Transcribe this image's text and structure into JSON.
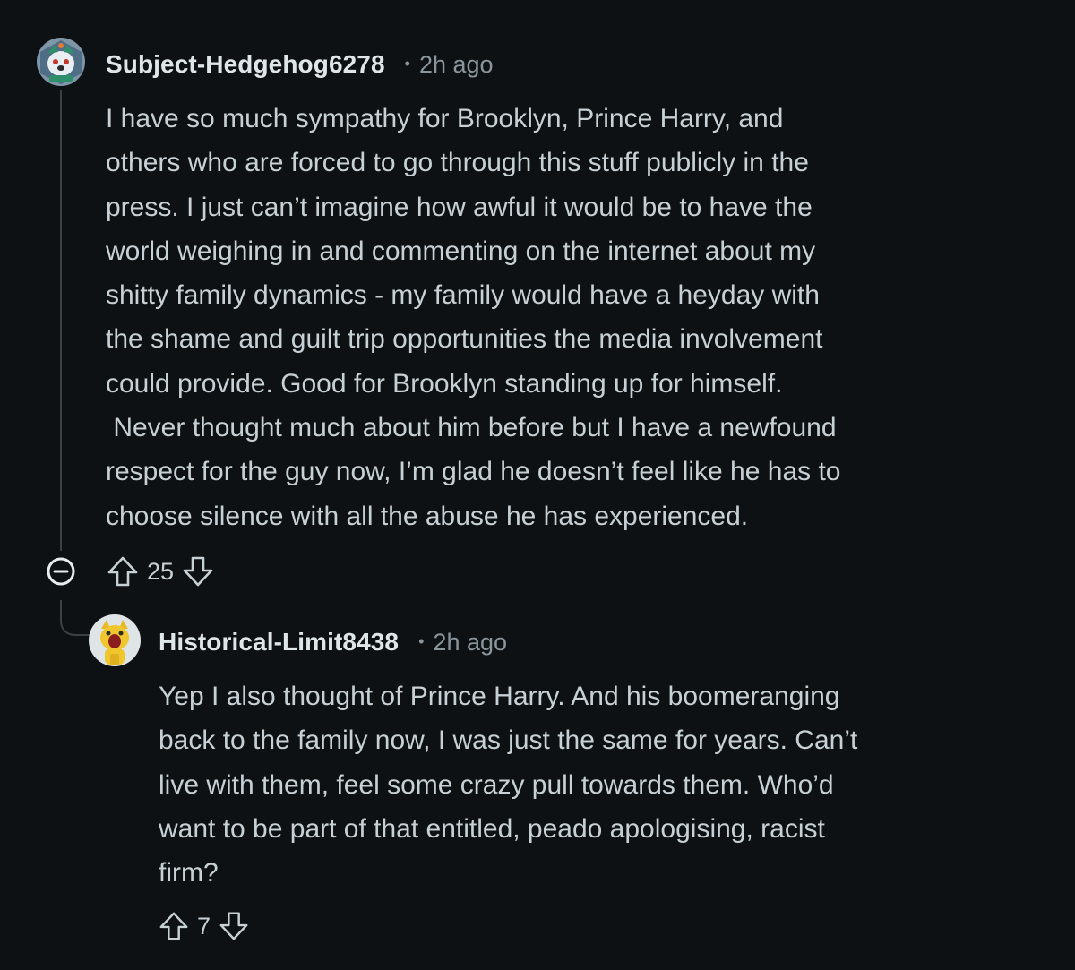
{
  "comments": [
    {
      "username": "Subject-Hedgehog6278",
      "separator": "•",
      "time": "2h ago",
      "avatar_icon": "hedgehog-avatar-icon",
      "body_lines": [
        "I have so much sympathy for Brooklyn, Prince Harry, and",
        "others who are forced to go through this stuff publicly in the",
        "press.  I just can’t imagine how awful it would be to have the",
        "world weighing in and commenting on the internet about my",
        "shitty family dynamics - my family would have a heyday with",
        "the shame and guilt trip opportunities the media involvement",
        "could provide.  Good for Brooklyn standing up for himself.",
        " Never thought much about him before but I have a newfound",
        "respect for the guy now, I’m glad he doesn’t feel like he has to",
        "choose silence with all the abuse he has experienced."
      ],
      "votes": "25"
    },
    {
      "username": "Historical-Limit8438",
      "separator": "•",
      "time": "2h ago",
      "avatar_icon": "cat-avatar-icon",
      "body_lines": [
        "Yep I also thought of Prince Harry. And his boomeranging",
        "back to the family now, I was just the same for years. Can’t",
        "live with them, feel some crazy pull towards them. Who’d",
        "want to be part of that entitled, peado apologising, racist",
        "firm?"
      ],
      "votes": "7"
    }
  ],
  "colors": {
    "background": "#0e1113",
    "text": "#c7d0d5",
    "username": "#dfe6ea",
    "meta": "#8a959c",
    "thread_line": "#3a4146"
  },
  "icons": {
    "upvote": "upvote-arrow-icon",
    "downvote": "downvote-arrow-icon",
    "collapse": "collapse-minus-icon"
  }
}
